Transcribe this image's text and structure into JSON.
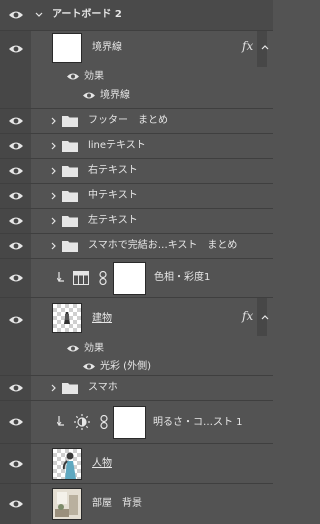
{
  "artboard": {
    "label": "アートボード 2"
  },
  "layers": {
    "border": {
      "label": "境界線",
      "fx": "fx",
      "effects_label": "効果",
      "effect_item": "境界線"
    },
    "footer_group": {
      "label": "フッター　まとめ"
    },
    "line_text": {
      "label": "lineテキスト"
    },
    "right_text": {
      "label": "右テキスト"
    },
    "middle_text": {
      "label": "中テキスト"
    },
    "left_text": {
      "label": "左テキスト"
    },
    "phone_group": {
      "label": "スマホで完結お…キスト　まとめ"
    },
    "hue_sat": {
      "label": "色相・彩度1"
    },
    "building": {
      "label": "建物",
      "fx": "fx",
      "effects_label": "効果",
      "effect_item": "光彩 (外側)"
    },
    "phone": {
      "label": "スマホ"
    },
    "brightness": {
      "label": "明るさ・コ…スト 1"
    },
    "person": {
      "label": "人物"
    },
    "room": {
      "label": "部屋　背景"
    }
  },
  "icons": {
    "eye": "eye-icon",
    "chevron": "chevron-right-icon",
    "folder": "folder-icon",
    "clip": "clipping-arrow-icon",
    "link": "chain-link-icon",
    "levels": "hue-saturation-adjustment-icon",
    "brightness": "brightness-contrast-adjustment-icon"
  },
  "colors": {
    "panel_bg": "#535353",
    "eye_column": "#474747",
    "separator": "#3f3f3f",
    "text": "#e6e6e6"
  }
}
